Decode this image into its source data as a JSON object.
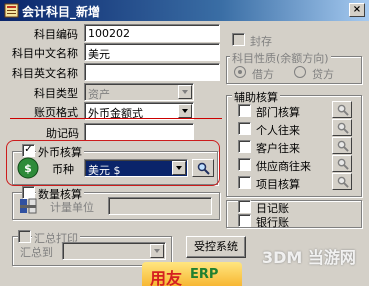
{
  "window": {
    "title": "会计科目_新增",
    "close_label": "×"
  },
  "form": {
    "code": {
      "label": "科目编码",
      "value": "100202"
    },
    "cn_name": {
      "label": "科目中文名称",
      "value": "美元"
    },
    "en_name": {
      "label": "科目英文名称",
      "value": ""
    },
    "type": {
      "label": "科目类型",
      "value": "资产"
    },
    "ledger_format": {
      "label": "账页格式",
      "value": "外币金额式"
    },
    "mnemonic": {
      "label": "助记码",
      "value": ""
    }
  },
  "seal": {
    "label": "封存"
  },
  "nature": {
    "legend": "科目性质(余额方向)",
    "options": [
      "借方",
      "贷方"
    ]
  },
  "foreign": {
    "label": "外币核算",
    "currency_label": "币种",
    "currency_value": "美元 $"
  },
  "quantity": {
    "label": "数量核算",
    "unit_label": "计量单位"
  },
  "summary": {
    "legend": "汇总打印",
    "to_label": "汇总到"
  },
  "aux": {
    "legend": "辅助核算",
    "items": [
      "部门核算",
      "个人往来",
      "客户往来",
      "供应商往来",
      "项目核算"
    ]
  },
  "journal": {
    "label": "日记账"
  },
  "bank": {
    "label": "银行账"
  },
  "controlled_label": "受控系统",
  "watermarks": {
    "brand": "用友",
    "brand2": "ERP",
    "site": "3DM 当游网"
  },
  "colors": {
    "accent_red": "#cc1c1c",
    "title_bar": "#0a246a",
    "selection": "#0a246a"
  }
}
